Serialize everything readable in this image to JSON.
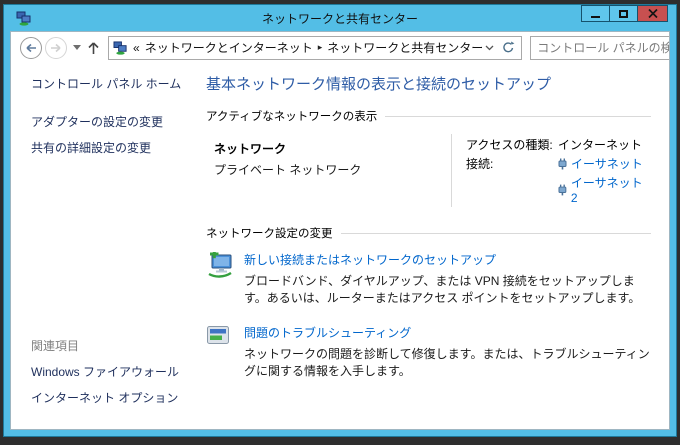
{
  "window": {
    "title": "ネットワークと共有センター"
  },
  "toolbar": {
    "breadcrumb_overflow": "«",
    "crumb_separator": "▸",
    "crumbs": [
      "ネットワークとインターネット",
      "ネットワークと共有センター"
    ],
    "search_placeholder": "コントロール パネルの検索"
  },
  "sidebar": {
    "home_label": "コントロール パネル ホーム",
    "tasks": [
      "アダプターの設定の変更",
      "共有の詳細設定の変更"
    ],
    "see_also_header": "関連項目",
    "see_also": [
      "Windows ファイアウォール",
      "インターネット オプション"
    ]
  },
  "main": {
    "heading": "基本ネットワーク情報の表示と接続のセットアップ",
    "active_networks": {
      "section_title": "アクティブなネットワークの表示",
      "network_name": "ネットワーク",
      "network_type": "プライベート ネットワーク",
      "access_label": "アクセスの種類:",
      "access_value": "インターネット",
      "connections_label": "接続:",
      "connections": [
        "イーサネット",
        "イーサネット 2"
      ]
    },
    "settings": {
      "section_title": "ネットワーク設定の変更",
      "items": [
        {
          "title": "新しい接続またはネットワークのセットアップ",
          "description": "ブロードバンド、ダイヤルアップ、または VPN 接続をセットアップします。あるいは、ルーターまたはアクセス ポイントをセットアップします。"
        },
        {
          "title": "問題のトラブルシューティング",
          "description": "ネットワークの問題を診断して修復します。または、トラブルシューティングに関する情報を入手します。"
        }
      ]
    }
  },
  "colors": {
    "frame_blue": "#53bee6",
    "close_red": "#c75050",
    "heading_blue": "#2e5ca6",
    "link_blue": "#0066cc",
    "sidebar_navy": "#1e2f5c",
    "desktop_dark": "#2e2e2e"
  }
}
